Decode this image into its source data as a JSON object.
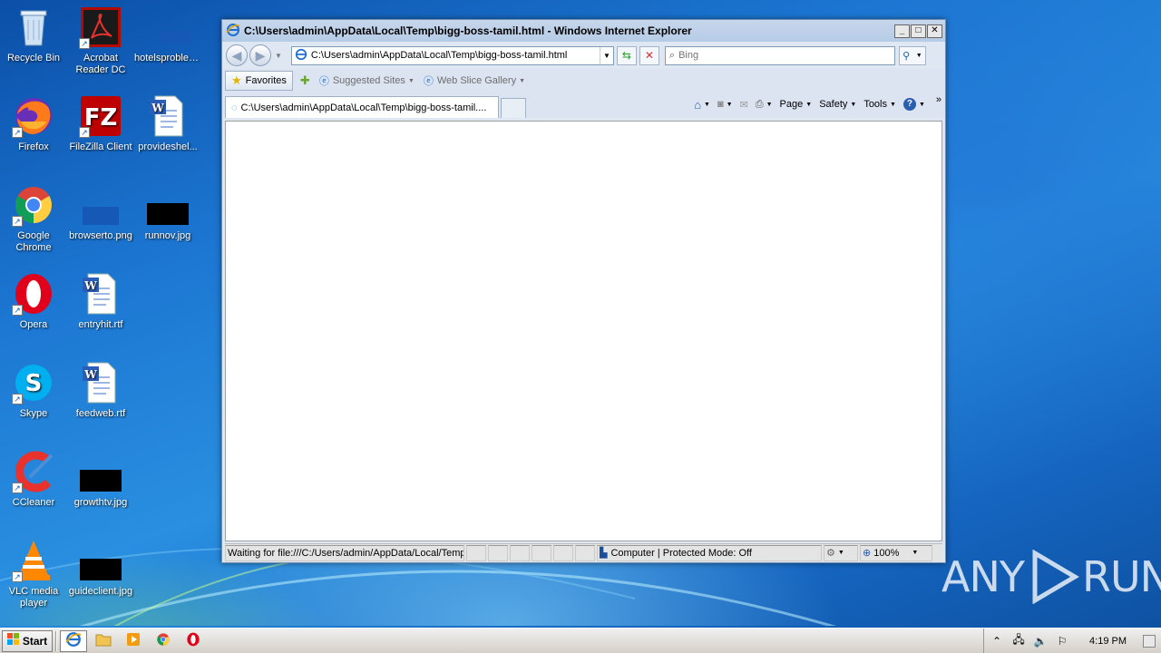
{
  "desktop": {
    "icons": [
      {
        "label": "Recycle Bin",
        "icon": "recycle-bin-icon"
      },
      {
        "label": "Acrobat Reader DC",
        "icon": "acrobat-icon"
      },
      {
        "label": "hotelsproblem...",
        "icon": "image-file-icon"
      },
      {
        "label": "Firefox",
        "icon": "firefox-icon"
      },
      {
        "label": "FileZilla Client",
        "icon": "filezilla-icon"
      },
      {
        "label": "provideshel...",
        "icon": "word-doc-icon"
      },
      {
        "label": "Google Chrome",
        "icon": "chrome-icon"
      },
      {
        "label": "browserto.png",
        "icon": "image-file-icon"
      },
      {
        "label": "runnov.jpg",
        "icon": "image-file-icon"
      },
      {
        "label": "Opera",
        "icon": "opera-icon"
      },
      {
        "label": "entryhit.rtf",
        "icon": "word-doc-icon"
      },
      {
        "label": "Skype",
        "icon": "skype-icon"
      },
      {
        "label": "feedweb.rtf",
        "icon": "word-doc-icon"
      },
      {
        "label": "CCleaner",
        "icon": "ccleaner-icon"
      },
      {
        "label": "growthtv.jpg",
        "icon": "image-file-icon"
      },
      {
        "label": "VLC media player",
        "icon": "vlc-icon"
      },
      {
        "label": "guideclient.jpg",
        "icon": "image-file-icon"
      }
    ]
  },
  "ie": {
    "title": "C:\\Users\\admin\\AppData\\Local\\Temp\\bigg-boss-tamil.html - Windows Internet Explorer",
    "address": "C:\\Users\\admin\\AppData\\Local\\Temp\\bigg-boss-tamil.html",
    "search_placeholder": "Bing",
    "favorites_label": "Favorites",
    "suggested_sites": "Suggested Sites",
    "web_slice_gallery": "Web Slice Gallery",
    "tab_title": "C:\\Users\\admin\\AppData\\Local\\Temp\\bigg-boss-tamil....",
    "cmd": {
      "page": "Page",
      "safety": "Safety",
      "tools": "Tools"
    },
    "status": {
      "text": "Waiting for file:///C:/Users/admin/AppData/Local/Temp",
      "zone": "Computer | Protected Mode: Off",
      "zoom": "100%"
    }
  },
  "taskbar": {
    "start": "Start",
    "clock": "4:19 PM"
  },
  "watermark": {
    "left": "ANY",
    "right": "RUN"
  },
  "colors": {
    "desktop": "#1c77d2",
    "ie_frame": "#dfe7f2",
    "taskbar": "#d4d0c8"
  }
}
